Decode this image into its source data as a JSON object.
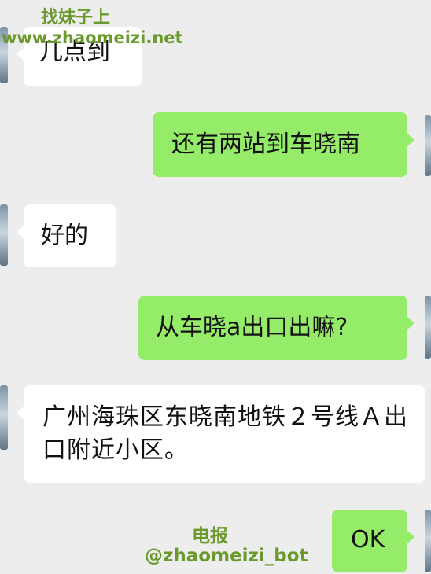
{
  "watermark": {
    "top_title": "找妹子上",
    "top_url": "www.zhaomeizi.net",
    "bottom_title": "电报",
    "bottom_handle": "@zhaomeizi_bot"
  },
  "messages": [
    {
      "side": "left",
      "text": "几点到"
    },
    {
      "side": "right",
      "text": "还有两站到车晓南"
    },
    {
      "side": "left",
      "text": "好的"
    },
    {
      "side": "right",
      "text": "从车晓a出口出嘛?"
    },
    {
      "side": "left",
      "text": "广州海珠区东晓南地铁２号线Ａ出口附近小区。"
    },
    {
      "side": "right",
      "text": "OK"
    }
  ],
  "colors": {
    "background": "#ededed",
    "incoming_bubble": "#ffffff",
    "outgoing_bubble": "#95ec69",
    "watermark": "#6a9a2c"
  },
  "icons": [
    "contact-avatar",
    "user-avatar"
  ]
}
